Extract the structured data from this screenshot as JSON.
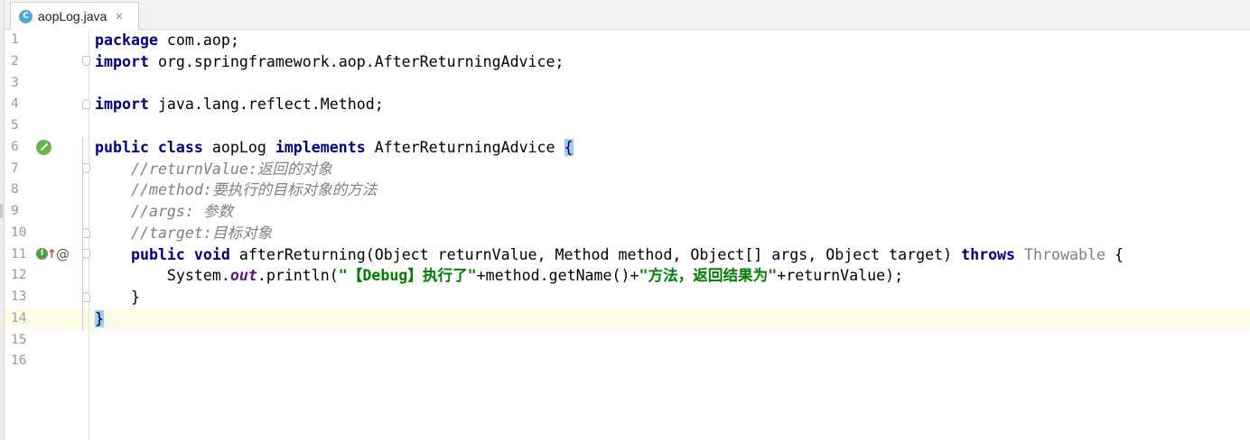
{
  "tab": {
    "file_name": "aopLog.java",
    "file_icon_letter": "C",
    "close_glyph": "✕"
  },
  "editor": {
    "line_numbers": [
      "1",
      "2",
      "3",
      "4",
      "5",
      "6",
      "7",
      "8",
      "9",
      "10",
      "11",
      "12",
      "13",
      "14",
      "15",
      "16"
    ],
    "current_line": 14,
    "lines": [
      [
        {
          "t": "package",
          "c": "kw"
        },
        {
          "t": " com.aop;"
        }
      ],
      [
        {
          "t": "import",
          "c": "kw"
        },
        {
          "t": " org.springframework.aop.AfterReturningAdvice;"
        }
      ],
      [],
      [
        {
          "t": "import",
          "c": "kw"
        },
        {
          "t": " java.lang.reflect.Method;"
        }
      ],
      [],
      [
        {
          "t": "public class",
          "c": "kw"
        },
        {
          "t": " aopLog "
        },
        {
          "t": "implements",
          "c": "kw"
        },
        {
          "t": " AfterReturningAdvice "
        },
        {
          "t": "{",
          "c": "brace-hl"
        }
      ],
      [
        {
          "t": "    "
        },
        {
          "t": "//returnValue:返回的对象",
          "c": "cm"
        }
      ],
      [
        {
          "t": "    "
        },
        {
          "t": "//method:要执行的目标对象的方法",
          "c": "cm"
        }
      ],
      [
        {
          "t": "    "
        },
        {
          "t": "//args: 参数",
          "c": "cm"
        }
      ],
      [
        {
          "t": "    "
        },
        {
          "t": "//target:目标对象",
          "c": "cm"
        }
      ],
      [
        {
          "t": "    "
        },
        {
          "t": "public void",
          "c": "kw"
        },
        {
          "t": " afterReturning(Object returnValue, Method method, Object[] args, Object target) "
        },
        {
          "t": "throws",
          "c": "kw"
        },
        {
          "t": " "
        },
        {
          "t": "Throwable",
          "c": "grey"
        },
        {
          "t": " {"
        }
      ],
      [
        {
          "t": "        System."
        },
        {
          "t": "out",
          "c": "fld"
        },
        {
          "t": ".println("
        },
        {
          "t": "\"【Debug】执行了\"",
          "c": "st"
        },
        {
          "t": "+method.getName()+"
        },
        {
          "t": "\"方法，返回结果为\"",
          "c": "st"
        },
        {
          "t": "+returnValue);"
        }
      ],
      [
        {
          "t": "    }"
        }
      ],
      [
        {
          "t": "}",
          "c": "brace-hl"
        }
      ],
      [],
      []
    ]
  },
  "gutter_icons": {
    "line6": "spring-bean-icon",
    "line11_implements": "implementing-method-icon",
    "line11_override_arrow": "↑",
    "line11_annotation": "@"
  },
  "colors": {
    "keyword": "#000080",
    "comment": "#808080",
    "string": "#008000",
    "static_field": "#660e7a",
    "current_line_bg": "#fdfbe6",
    "brace_match": "#99ccff"
  }
}
